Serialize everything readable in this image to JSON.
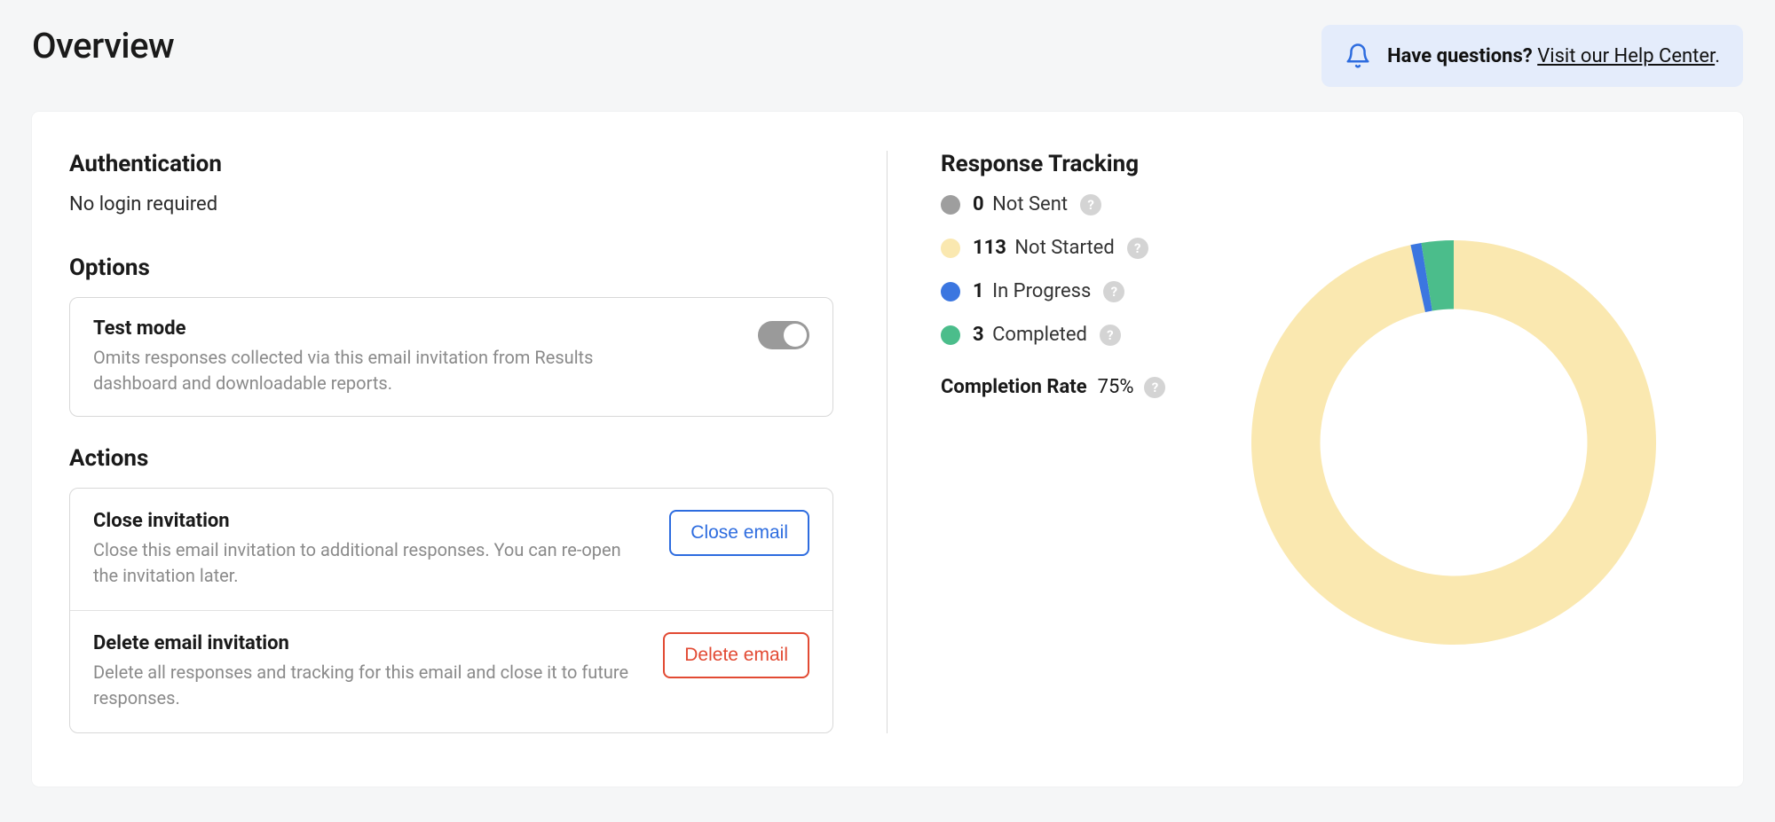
{
  "header": {
    "title": "Overview",
    "help_prompt": "Have questions?",
    "help_link_text": "Visit our Help Center",
    "help_trailing": "."
  },
  "authentication": {
    "title": "Authentication",
    "status": "No login required"
  },
  "options": {
    "title": "Options",
    "test_mode": {
      "title": "Test mode",
      "description": "Omits responses collected via this email invitation from Results dashboard and downloadable reports.",
      "enabled": false
    }
  },
  "actions": {
    "title": "Actions",
    "close": {
      "title": "Close invitation",
      "description": "Close this email invitation to additional responses. You can re-open the invitation later.",
      "button": "Close email"
    },
    "delete": {
      "title": "Delete email invitation",
      "description": "Delete all responses and tracking for this email and close it to future responses.",
      "button": "Delete email"
    }
  },
  "tracking": {
    "title": "Response Tracking",
    "items": [
      {
        "count": "0",
        "label": "Not Sent",
        "color": "#9e9e9e"
      },
      {
        "count": "113",
        "label": "Not Started",
        "color": "#fae8b0"
      },
      {
        "count": "1",
        "label": "In Progress",
        "color": "#3b76e0"
      },
      {
        "count": "3",
        "label": "Completed",
        "color": "#4bbd8b"
      }
    ],
    "completion_label": "Completion Rate",
    "completion_value": "75%"
  },
  "chart_data": {
    "type": "pie",
    "title": "Response Tracking",
    "series": [
      {
        "name": "Not Sent",
        "value": 0,
        "color": "#9e9e9e"
      },
      {
        "name": "Not Started",
        "value": 113,
        "color": "#fae8b0"
      },
      {
        "name": "In Progress",
        "value": 1,
        "color": "#3b76e0"
      },
      {
        "name": "Completed",
        "value": 3,
        "color": "#4bbd8b"
      }
    ],
    "donut": true,
    "inner_radius_ratio": 0.66
  }
}
